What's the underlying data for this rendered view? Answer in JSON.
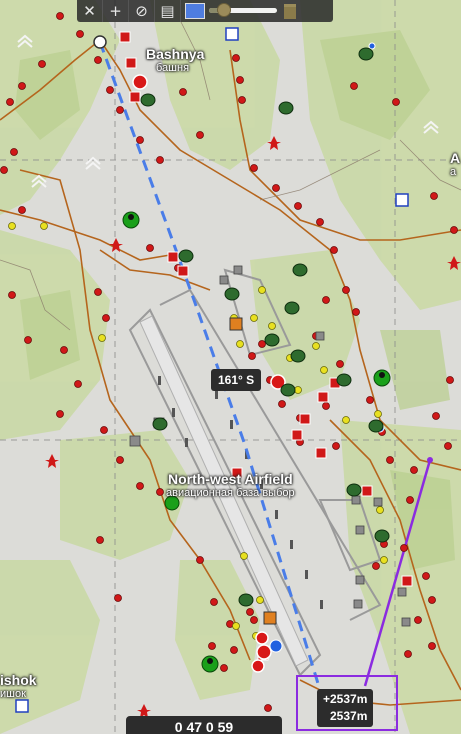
{
  "toolbar": {
    "tools": [
      {
        "name": "close",
        "glyph": "✕"
      },
      {
        "name": "add",
        "glyph": "+"
      },
      {
        "name": "compass",
        "glyph": "⊘"
      },
      {
        "name": "ruler",
        "glyph": "▤"
      }
    ],
    "color_swatch": "#4f7de0",
    "opacity_slider_value": 0.15
  },
  "places": {
    "bashnya": {
      "name": "Bashnya",
      "name_local": "башня"
    },
    "airfield": {
      "name": "North-west Airfield",
      "name_local": "авиационная база выбор"
    },
    "edge_left": {
      "name": "ishok",
      "name_local": "ишок"
    },
    "edge_right": {
      "name": "A",
      "name_local": "а"
    }
  },
  "measurement": {
    "bearing": "161° S",
    "delta": "+2537m",
    "distance": "2537m"
  },
  "coordinate_readout": "0 47 0 59",
  "colors": {
    "terrain": "#dcdcd8",
    "forest": "#c9d8a8",
    "road": "#b5651d",
    "route_line": "#4a7de8",
    "measure_line": "#8b2be0",
    "marker_red": "#d01818",
    "marker_yellow": "#e8e020",
    "marker_green": "#1aa01a"
  }
}
